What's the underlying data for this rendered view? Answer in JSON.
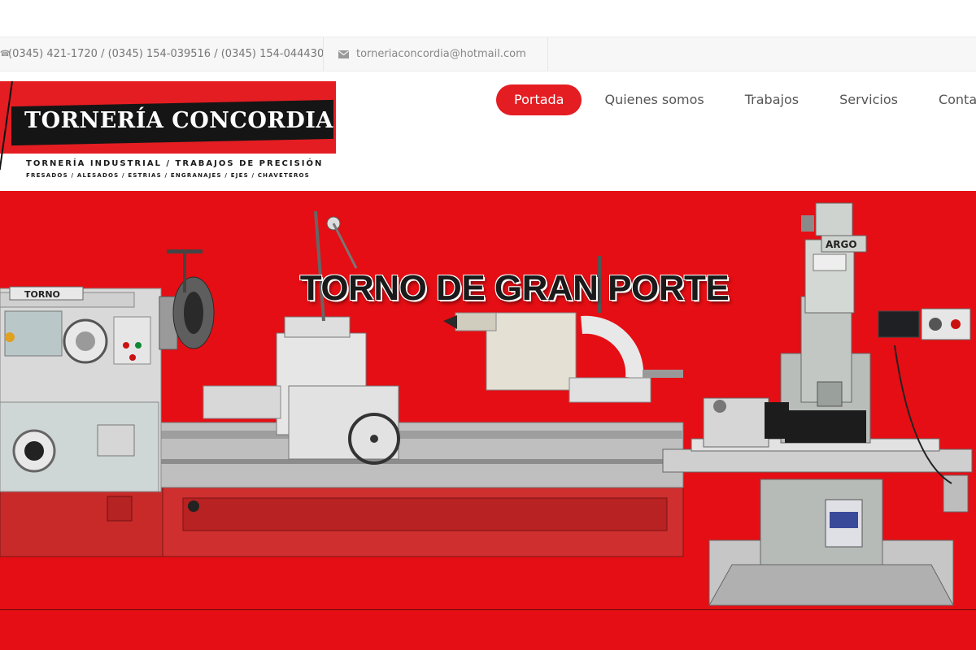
{
  "contact": {
    "phone_icon": "phone-icon",
    "phones": "(0345) 421-1720 / (0345) 154-039516 / (0345) 154-044430",
    "email_icon": "envelope-icon",
    "email": "torneriaconcordia@hotmail.com"
  },
  "logo": {
    "name": "TORNERÍA CONCORDIA",
    "tagline": "TORNERÍA INDUSTRIAL / TRABAJOS DE PRECISIÓN",
    "services": "FRESADOS / ALESADOS / ESTRIAS / ENGRANAJES / EJES / CHAVETEROS",
    "colors": {
      "red": "#e41d22",
      "black": "#151515"
    }
  },
  "nav": {
    "items": [
      {
        "label": "Portada",
        "active": true
      },
      {
        "label": "Quienes somos"
      },
      {
        "label": "Trabajos"
      },
      {
        "label": "Servicios"
      },
      {
        "label": "Contact"
      }
    ]
  },
  "hero": {
    "title": "TORNO DE GRAN PORTE",
    "background": "#e50e14",
    "lathe_label": "TORNO",
    "mill_label": "ARGO"
  }
}
